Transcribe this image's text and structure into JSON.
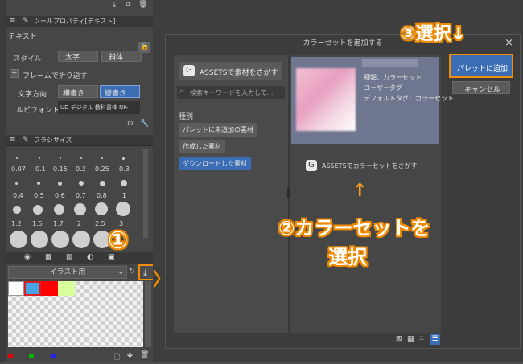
{
  "colors": {
    "accent": "#f28c00",
    "selection": "#3a6db3"
  },
  "tool_property": {
    "title": "ツールプロパティ[テキスト]",
    "name": "テキスト",
    "style_label": "スタイル",
    "style_bold": "太字",
    "style_italic": "斜体",
    "wrap_label": "フレームで折り返す",
    "direction_label": "文字方向",
    "direction_horizontal": "横書き",
    "direction_vertical": "縦書き",
    "font_label": "ルビフォント",
    "font_value": "UD デジタル 教科書体 NK-"
  },
  "brush_size": {
    "title": "ブラシサイズ",
    "row1": [
      "0.07",
      "0.1",
      "0.15",
      "0.2",
      "0.25",
      "0.3"
    ],
    "row2": [
      "0.4",
      "0.5",
      "0.6",
      "0.7",
      "0.8",
      "1"
    ],
    "row3": [
      "1.2",
      "1.5",
      "1.7",
      "2",
      "2.5",
      "3"
    ]
  },
  "color_set": {
    "selected": "イラスト用",
    "swatches": [
      "#ffffff",
      "#4aa3e6",
      "#ff0000",
      "#d8ff9e"
    ]
  },
  "dialog": {
    "title": "カラーセットを追加する",
    "close": "×",
    "assets_button": "ASSETSで素材をさがす",
    "search_placeholder": "検索キーワードを入力して...",
    "category_label": "種別",
    "categories": [
      "パレットに未追加の素材",
      "作成した素材",
      "ダウンロードした素材"
    ],
    "item_info": [
      "種類：カラーセット",
      "ユーザータグ",
      "デフォルトタグ：カラーセット"
    ],
    "center_assets_link": "ASSETSでカラーセットをさがす",
    "add_button": "パレットに追加",
    "cancel_button": "キャンセル"
  },
  "annotations": {
    "step1": "①",
    "step2_line1": "②カラーセットを",
    "step2_line2": "選択",
    "step3": "③選択↓",
    "up_arrow": "↑"
  }
}
